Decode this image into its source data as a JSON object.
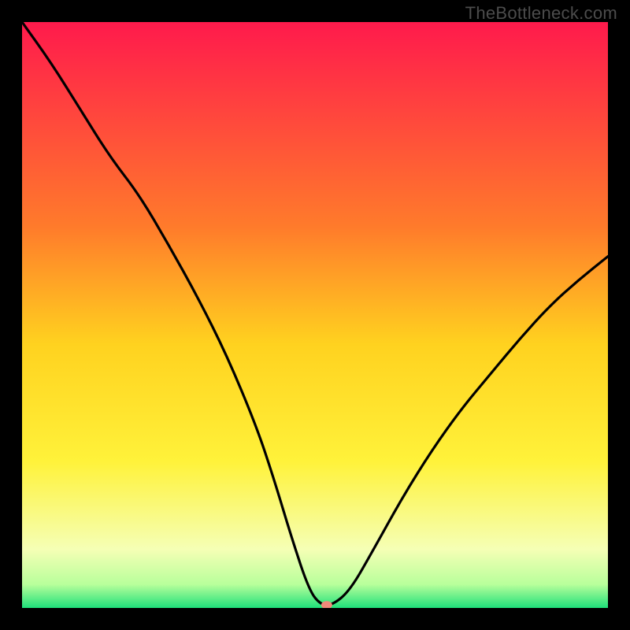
{
  "watermark": "TheBottleneck.com",
  "chart_data": {
    "type": "line",
    "title": "",
    "xlabel": "",
    "ylabel": "",
    "xlim": [
      0,
      100
    ],
    "ylim": [
      0,
      100
    ],
    "gradient": {
      "stops": [
        {
          "offset": 0,
          "color": "#ff1a4c"
        },
        {
          "offset": 35,
          "color": "#ff7b2b"
        },
        {
          "offset": 55,
          "color": "#ffd21f"
        },
        {
          "offset": 75,
          "color": "#fff23a"
        },
        {
          "offset": 90,
          "color": "#f5ffb5"
        },
        {
          "offset": 96,
          "color": "#b8ff9b"
        },
        {
          "offset": 100,
          "color": "#1fe07a"
        }
      ]
    },
    "x": [
      0,
      5,
      10,
      15,
      20,
      25,
      30,
      35,
      40,
      43,
      46,
      49,
      51,
      53,
      56,
      60,
      65,
      70,
      75,
      80,
      85,
      90,
      95,
      100
    ],
    "y": [
      100,
      93,
      85,
      77,
      70.5,
      62,
      53,
      43,
      31,
      22,
      12,
      3,
      0.5,
      0.5,
      3,
      10,
      19,
      27,
      34,
      40,
      46,
      51.5,
      56,
      60
    ],
    "marker": {
      "x": 52,
      "y": 0.5,
      "color": "#f08a7a",
      "rx": 7,
      "ry": 5
    }
  }
}
